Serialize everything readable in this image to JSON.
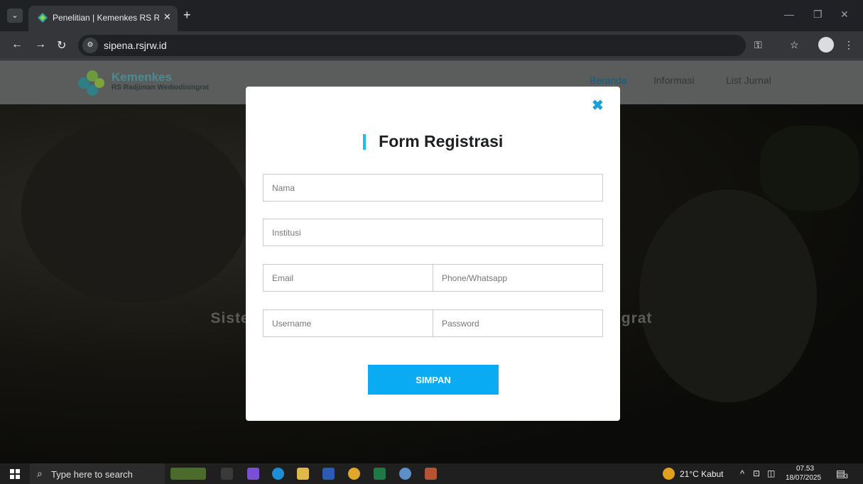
{
  "browser": {
    "tab_title": "Penelitian | Kemenkes RS Radjiman",
    "url": "sipena.rsjrw.id",
    "tab_close_glyph": "✕",
    "new_tab_glyph": "+"
  },
  "site": {
    "logo_name": "Kemenkes",
    "logo_sub": "RS Radjiman Wediodiningrat",
    "nav": [
      "Beranda",
      "Informasi",
      "List Jurnal"
    ],
    "hero_text": "Sistem Informasi Penelitian RS Radjiman Wediodiningrat"
  },
  "modal": {
    "close_glyph": "✖",
    "title": "Form Registrasi",
    "fields": {
      "nama": "Nama",
      "institusi": "Institusi",
      "email": "Email",
      "phone": "Phone/Whatsapp",
      "username": "Username",
      "password": "Password"
    },
    "submit_label": "SIMPAN"
  },
  "taskbar": {
    "search_placeholder": "Type here to search",
    "weather": "21°C  Kabut",
    "time": "07.53",
    "date": "18/07/2025",
    "notification_count": "3"
  },
  "colors": {
    "accent": "#18c3e6",
    "button": "#0aabf2",
    "close": "#1a9fd9",
    "nav_active": "#0a5f86"
  }
}
